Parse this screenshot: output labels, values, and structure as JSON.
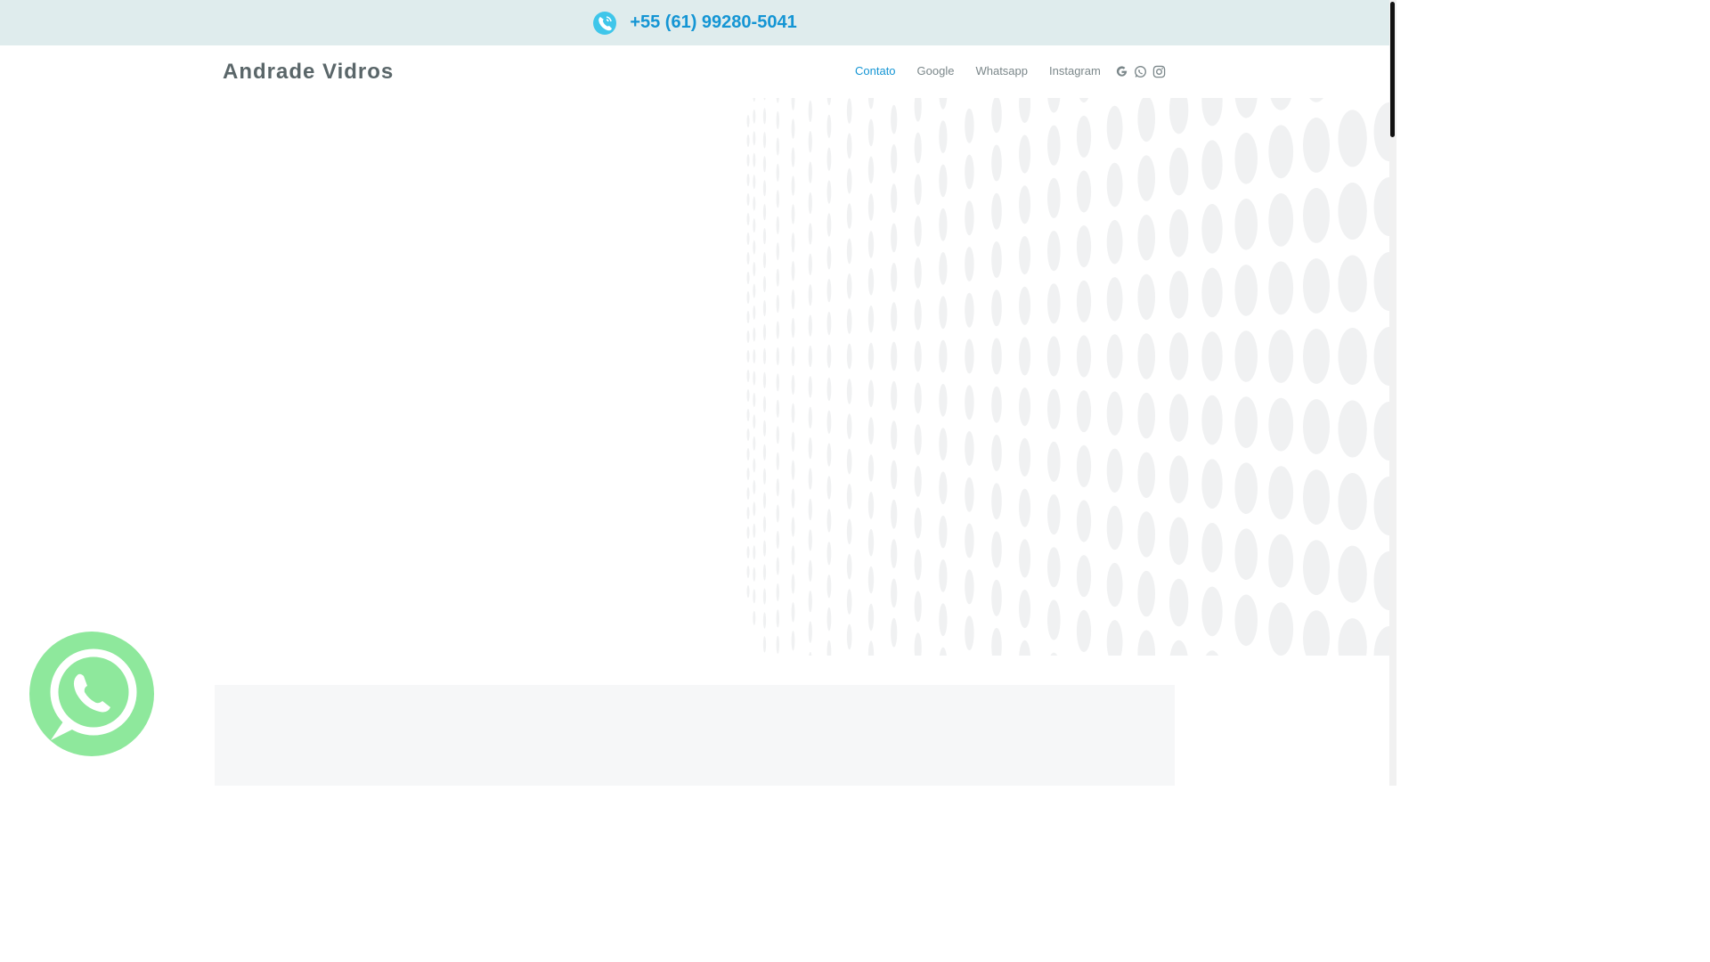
{
  "topbar": {
    "phone": "+55 (61) 99280-5041",
    "phone_icon": "phone-call-icon"
  },
  "navbar": {
    "brand": "Andrade Vidros",
    "links": [
      {
        "label": "Contato",
        "active": true
      },
      {
        "label": "Google",
        "active": false
      },
      {
        "label": "Whatsapp",
        "active": false
      },
      {
        "label": "Instagram",
        "active": false
      }
    ],
    "social_icons": [
      "google-icon",
      "whatsapp-icon",
      "instagram-icon"
    ]
  },
  "colors": {
    "accent": "#1495d4",
    "topbar_bg": "#dfeced",
    "brand_text": "#5a6669",
    "whatsapp_float": "#8ee89c"
  }
}
